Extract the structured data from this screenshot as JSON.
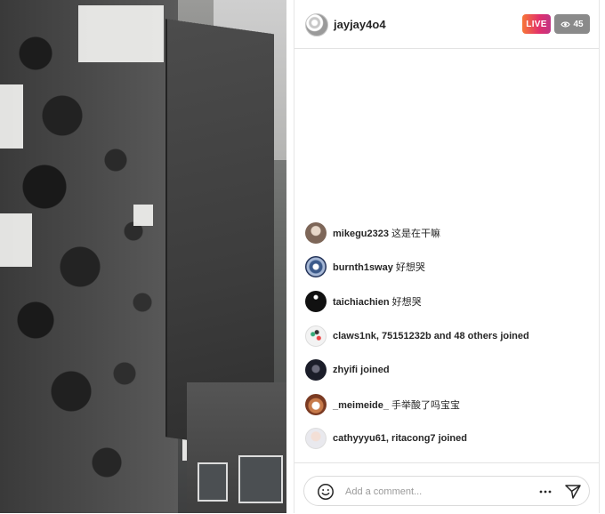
{
  "stream": {
    "username": "jayjay4o4",
    "live_label": "LIVE",
    "viewer_count": "45",
    "viewer_icon": "eye-icon"
  },
  "comments": [
    {
      "user": "mikegu2323",
      "text": "这是在干嘛",
      "avatar": "photo-avatar"
    },
    {
      "user": "burnth1sway",
      "text": "好想哭",
      "avatar": "snowflake-avatar"
    },
    {
      "user": "taichiachien",
      "text": "好想哭",
      "avatar": "dark-avatar"
    },
    {
      "user": "",
      "text": "claws1nk, 75151232b and 48 others joined",
      "avatar": "cartoon-avatar"
    },
    {
      "user": "",
      "text": "zhyifi joined",
      "avatar": "dark-figure-avatar"
    },
    {
      "user": "_meimeide_",
      "text": "手举酸了吗宝宝",
      "avatar": "dog-avatar"
    },
    {
      "user": "",
      "text": "cathyyyu61, ritacong7 joined",
      "avatar": "anime-avatar"
    }
  ],
  "composer": {
    "placeholder": "Add a comment...",
    "emoji_icon": "smiley-icon",
    "more_icon": "more-icon",
    "send_icon": "send-icon"
  },
  "colors": {
    "live_gradient_start": "#f77737",
    "live_gradient_end": "#c13584",
    "viewer_badge": "#8a8a8a",
    "text": "#262626",
    "placeholder": "#9a9a9a"
  }
}
